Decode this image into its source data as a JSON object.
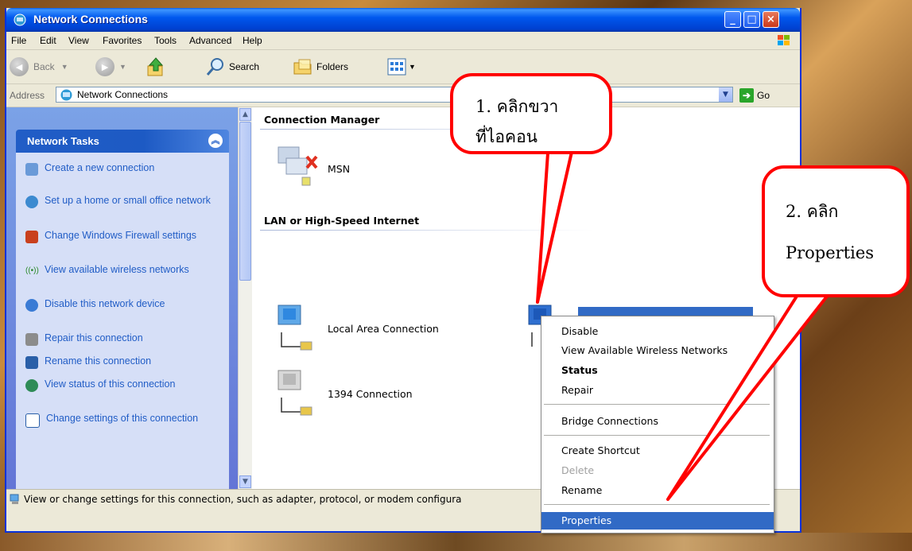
{
  "window": {
    "title": "Network Connections"
  },
  "menu": [
    "File",
    "Edit",
    "View",
    "Favorites",
    "Tools",
    "Advanced",
    "Help"
  ],
  "toolbar": {
    "back": "Back",
    "search": "Search",
    "folders": "Folders"
  },
  "address": {
    "label": "Address",
    "value": "Network Connections",
    "go": "Go"
  },
  "tasks": {
    "header": "Network Tasks",
    "items": [
      {
        "label": "Create a new connection",
        "icon": "new-connection-icon"
      },
      {
        "label": "Set up a home or small office network",
        "icon": "home-network-icon"
      },
      {
        "label": "Change Windows Firewall settings",
        "icon": "firewall-icon"
      },
      {
        "label": "View available wireless networks",
        "icon": "wireless-icon"
      },
      {
        "label": "Disable this network device",
        "icon": "disable-icon"
      },
      {
        "label": "Repair this connection",
        "icon": "repair-icon"
      },
      {
        "label": "Rename this connection",
        "icon": "rename-icon"
      },
      {
        "label": "View status of this connection",
        "icon": "status-icon"
      },
      {
        "label": "Change settings of this connection",
        "icon": "settings-icon"
      }
    ]
  },
  "groups": {
    "connection_manager": {
      "header": "Connection Manager",
      "items": [
        "MSN"
      ]
    },
    "lan": {
      "header": "LAN or High-Speed Internet",
      "items": [
        "Local Area Connection",
        "1394 Connection"
      ]
    }
  },
  "context_menu": {
    "items": [
      "Disable",
      "View Available Wireless Networks",
      "Status",
      "Repair",
      "Bridge Connections",
      "Create Shortcut",
      "Delete",
      "Rename",
      "Properties"
    ],
    "selected": "Properties",
    "default": "Status",
    "disabled": [
      "Delete"
    ]
  },
  "status_bar": {
    "text": "View or change settings for this connection, such as adapter, protocol, or modem configura"
  },
  "callouts": {
    "c1_line1": "1. คลิกขวา",
    "c1_line2": "ที่ไอคอน",
    "c2_line1": "2. คลิก",
    "c2_line2": "Properties"
  },
  "colors": {
    "callout_border": "#ff0000",
    "selection": "#316ac5",
    "task_link": "#215dc6"
  }
}
